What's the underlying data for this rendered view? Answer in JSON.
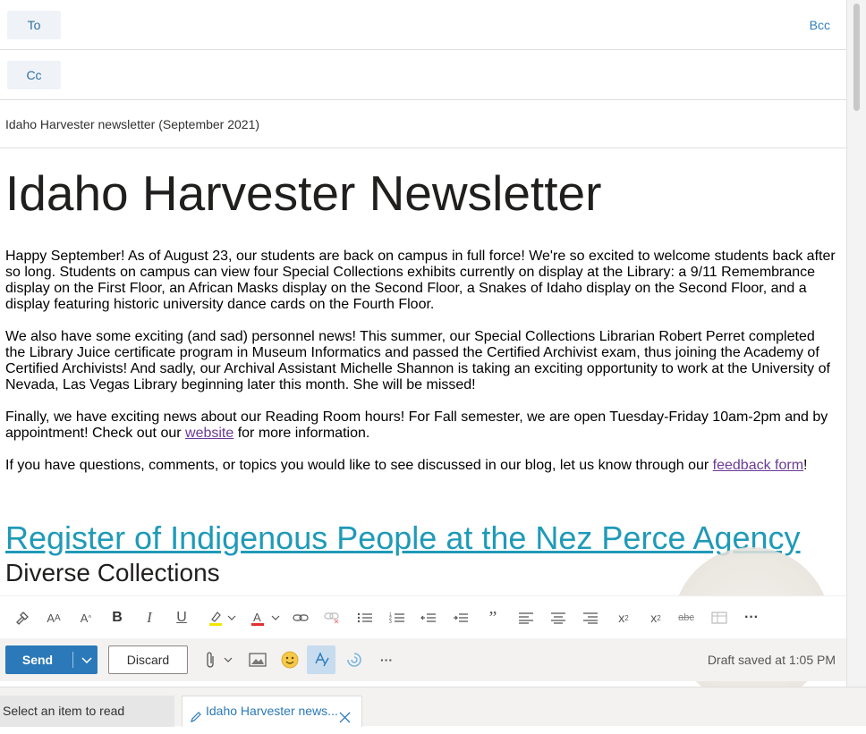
{
  "recipients": {
    "to_label": "To",
    "cc_label": "Cc",
    "bcc_label": "Bcc"
  },
  "subject": "Idaho Harvester newsletter (September 2021)",
  "body": {
    "heading": "Idaho Harvester Newsletter",
    "p1": "Happy September! As of August 23, our students are back on campus in full force! We're so excited to welcome students back after so long. Students on campus can view four Special Collections exhibits currently on display at the Library: a 9/11 Remembrance display on the First Floor, an African Masks display on the Second Floor, a Snakes of Idaho display on the Second Floor, and a display featuring historic university dance cards on the Fourth Floor.",
    "p2": "We also have some exciting (and sad) personnel news! This summer, our Special Collections Librarian Robert Perret completed the Library Juice certificate program in Museum Informatics and passed the Certified Archivist exam, thus joining the Academy of Certified Archivists! And sadly, our Archival Assistant Michelle Shannon is taking an exciting opportunity to work at the University of Nevada, Las Vegas Library beginning later this month. She will be missed!",
    "p3_before": "Finally, we have exciting news about our Reading Room hours! For Fall semester, we are open Tuesday-Friday 10am-2pm and by appointment! Check out our ",
    "p3_link": "website",
    "p3_after": " for more information.",
    "p4_before": "If you have questions, comments, or topics you would like to see discussed in our blog, let us know through our ",
    "p4_link": "feedback form",
    "p4_after": "!",
    "h2": "Register of Indigenous People at the Nez Perce Agency",
    "h3": "Diverse Collections"
  },
  "actions": {
    "send_label": "Send",
    "discard_label": "Discard",
    "draft_status": "Draft saved at 1:05 PM"
  },
  "tabs": {
    "tab1_label": "Select an item to read",
    "tab2_label": "Idaho Harvester news..."
  },
  "colors": {
    "accent": "#2b79b8",
    "link_visited": "#6b3a96",
    "heading_link": "#1f9ab8"
  }
}
